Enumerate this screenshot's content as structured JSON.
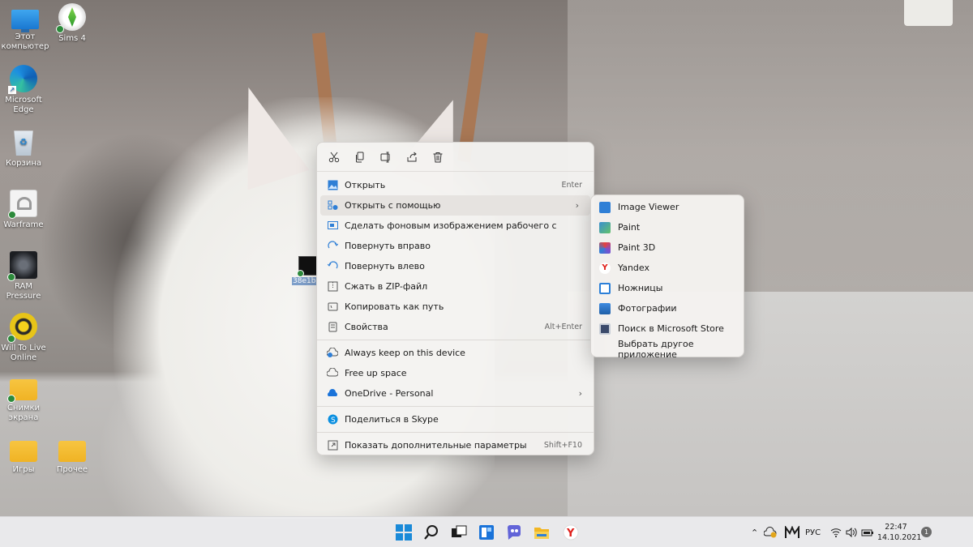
{
  "desktop_icons": [
    {
      "label": "Этот компьютер",
      "icon": "monitor-icon"
    },
    {
      "label": "Sims 4",
      "icon": "sims-icon"
    },
    {
      "label": "Microsoft Edge",
      "icon": "edge-icon"
    },
    {
      "label": "Корзина",
      "icon": "recycle-bin-icon"
    },
    {
      "label": "Warframe",
      "icon": "warframe-icon"
    },
    {
      "label": "RAM Pressure",
      "icon": "ram-pressure-icon"
    },
    {
      "label": "Will To Live Online",
      "icon": "will-to-live-icon"
    },
    {
      "label": "Снимки экрана",
      "icon": "folder-icon"
    },
    {
      "label": "Игры",
      "icon": "folder-icon"
    },
    {
      "label": "Прочее",
      "icon": "folder-icon"
    }
  ],
  "selected_file": {
    "label": "38e1b6..."
  },
  "context_menu": {
    "toolbar": [
      "cut-icon",
      "copy-icon",
      "rename-icon",
      "share-icon",
      "delete-icon"
    ],
    "items": [
      {
        "label": "Открыть",
        "accel": "Enter"
      },
      {
        "label": "Открыть с помощью",
        "accel": "",
        "submenu": true
      },
      {
        "label": "Сделать фоновым изображением рабочего с",
        "accel": ""
      },
      {
        "label": "Повернуть вправо",
        "accel": ""
      },
      {
        "label": "Повернуть влево",
        "accel": ""
      },
      {
        "label": "Сжать в ZIP-файл",
        "accel": ""
      },
      {
        "label": "Копировать как путь",
        "accel": ""
      },
      {
        "label": "Свойства",
        "accel": "Alt+Enter"
      },
      {
        "label": "Always keep on this device",
        "accel": ""
      },
      {
        "label": "Free up space",
        "accel": ""
      },
      {
        "label": "OneDrive - Personal",
        "accel": "",
        "submenu": true
      },
      {
        "label": "Поделиться в Skype",
        "accel": ""
      },
      {
        "label": "Показать дополнительные параметры",
        "accel": "Shift+F10"
      }
    ]
  },
  "submenu": {
    "items": [
      {
        "label": "Image Viewer",
        "color": "#2f7fd6"
      },
      {
        "label": "Paint",
        "color": "#3a8fd0"
      },
      {
        "label": "Paint 3D",
        "color": "#7a4fd0"
      },
      {
        "label": "Yandex",
        "color": "#e0201b"
      },
      {
        "label": "Ножницы",
        "color": "#2b7fd8"
      },
      {
        "label": "Фотографии",
        "color": "#1f6fb8"
      },
      {
        "label": "Поиск в Microsoft Store",
        "color": "#3b4a6b"
      },
      {
        "label": "Выбрать другое приложение",
        "color": ""
      }
    ]
  },
  "taskbar": {
    "apps": [
      "windows-start-icon",
      "search-icon",
      "task-view-icon",
      "widgets-icon",
      "chat-icon",
      "file-explorer-icon",
      "yandex-browser-icon"
    ],
    "tray": {
      "language": "РУС",
      "time": "22:47",
      "date": "14.10.2021",
      "notifications": "1"
    }
  }
}
